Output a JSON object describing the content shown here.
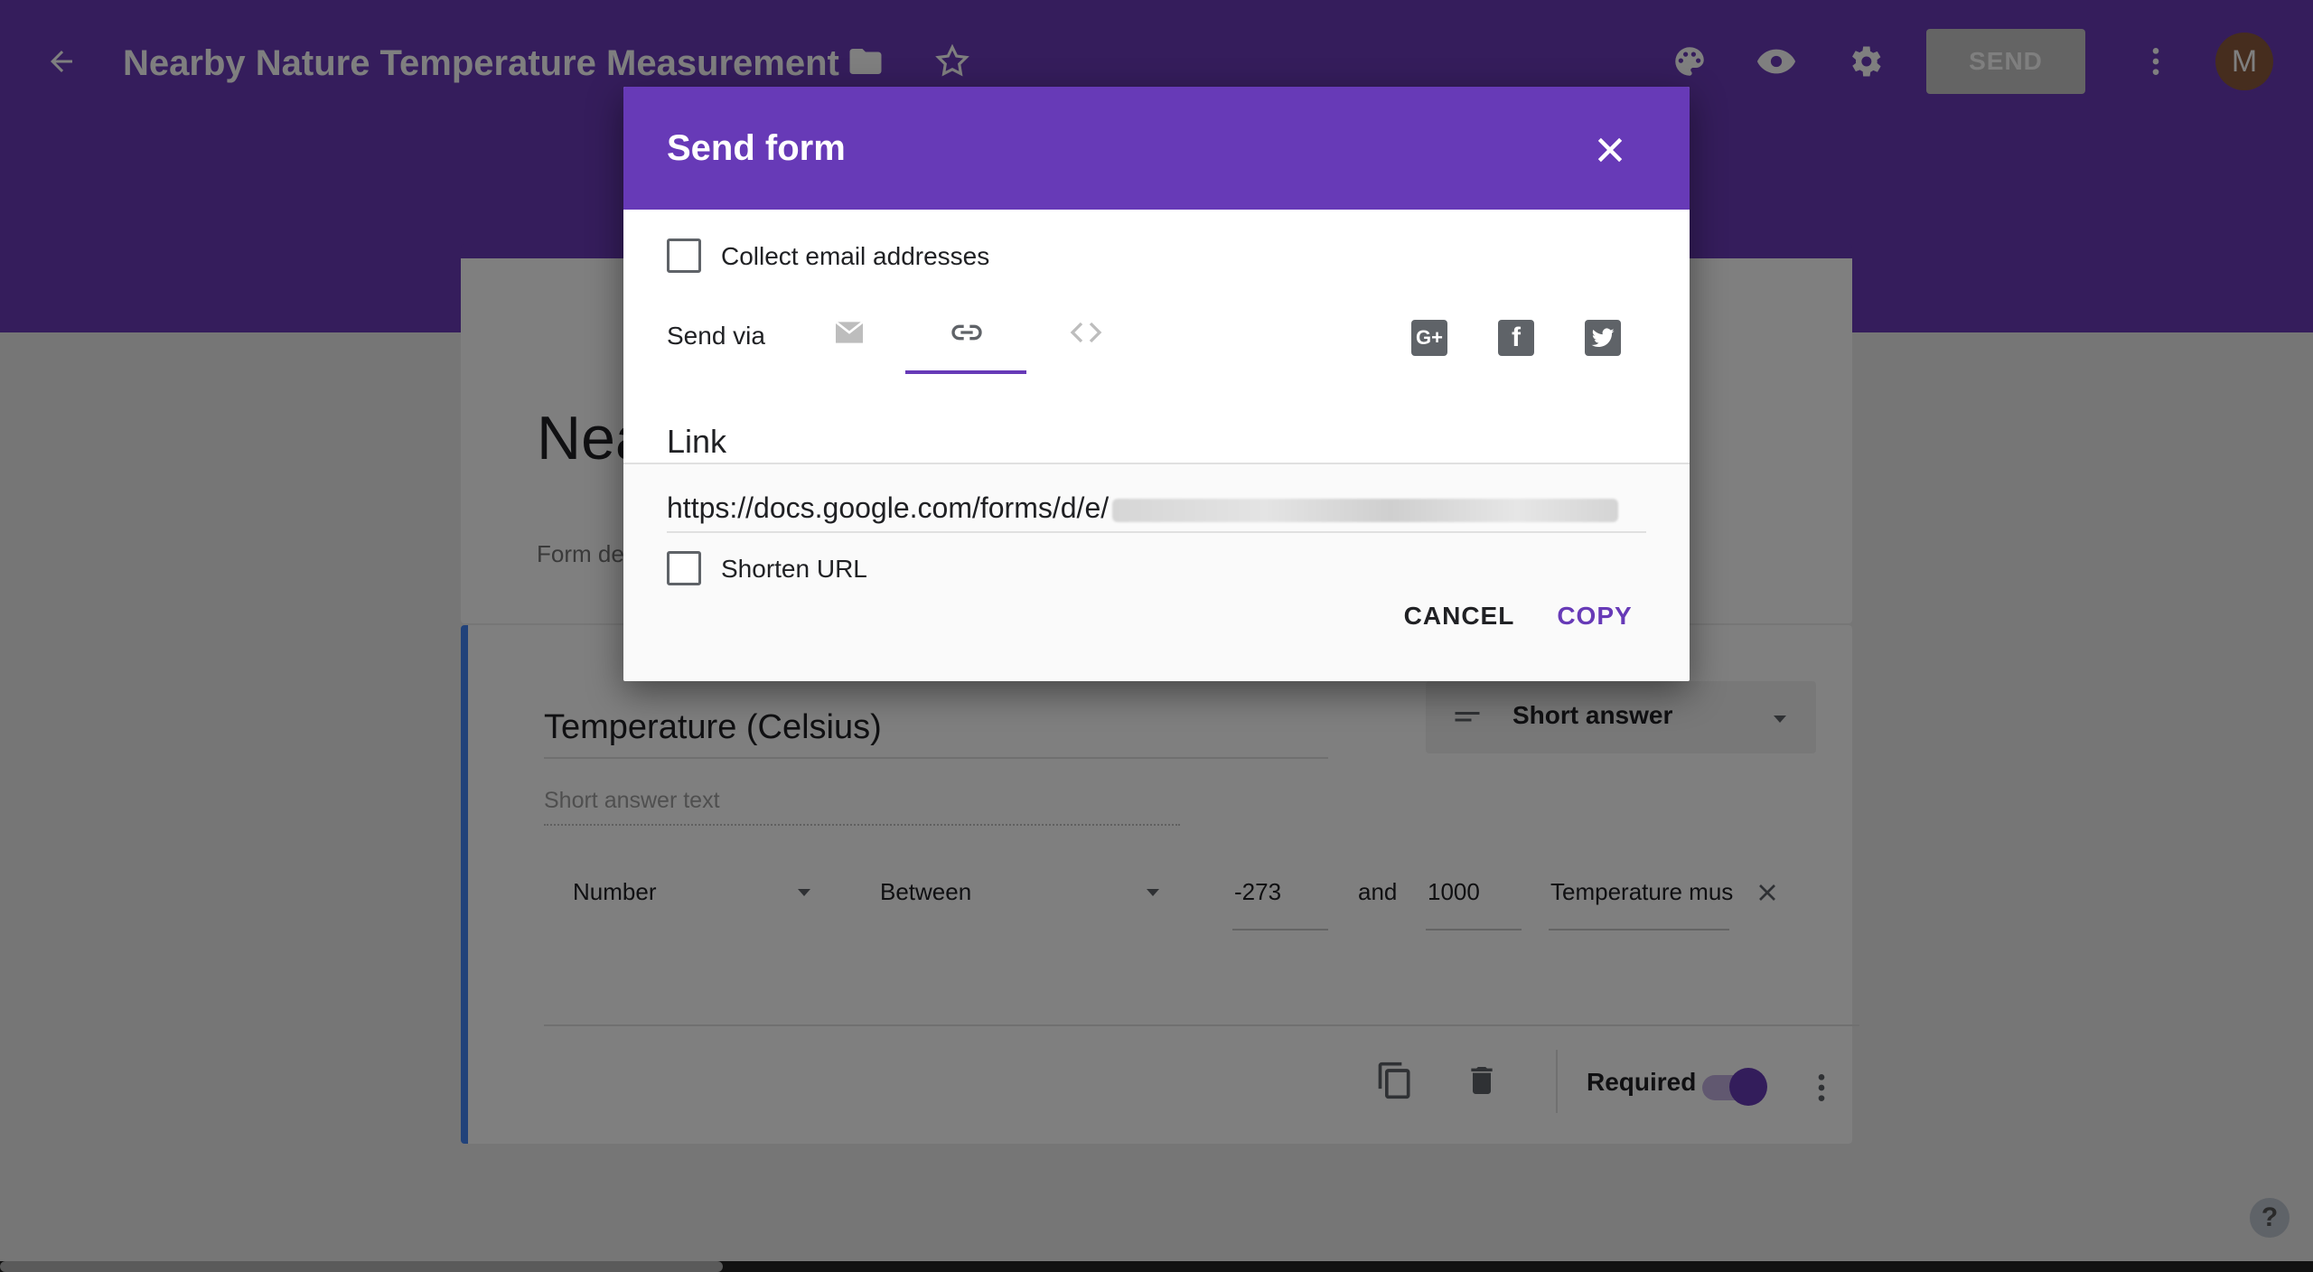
{
  "topbar": {
    "title": "Nearby Nature Temperature Measurement",
    "send_label": "SEND",
    "avatar_initial": "M",
    "icons": [
      "back-arrow-icon",
      "folder-icon",
      "star-icon",
      "palette-icon",
      "eye-icon",
      "gear-icon",
      "more-vert-icon"
    ]
  },
  "form": {
    "title": "Nea",
    "description": "Form de",
    "question": {
      "title": "Temperature (Celsius)",
      "type": "Short answer",
      "placeholder": "Short answer text",
      "validation": {
        "kind": "Number",
        "op": "Between",
        "min": "-273",
        "and_label": "and",
        "max": "1000",
        "error_text": "Temperature mus"
      },
      "required_label": "Required",
      "required": true
    }
  },
  "dialog": {
    "title": "Send form",
    "collect_email_label": "Collect email addresses",
    "send_via_label": "Send via",
    "tabs": [
      "email",
      "link",
      "embed"
    ],
    "active_tab": "link",
    "social": [
      "google-plus",
      "facebook",
      "twitter"
    ],
    "link_label": "Link",
    "link_url": "https://docs.google.com/forms/d/e/",
    "shorten_url_label": "Shorten URL",
    "cancel_label": "CANCEL",
    "copy_label": "COPY"
  },
  "colors": {
    "brand_purple": "#673ab7",
    "topbar_purple": "#6a3ab8",
    "accent_blue": "#4285f4"
  },
  "help_label": "?"
}
